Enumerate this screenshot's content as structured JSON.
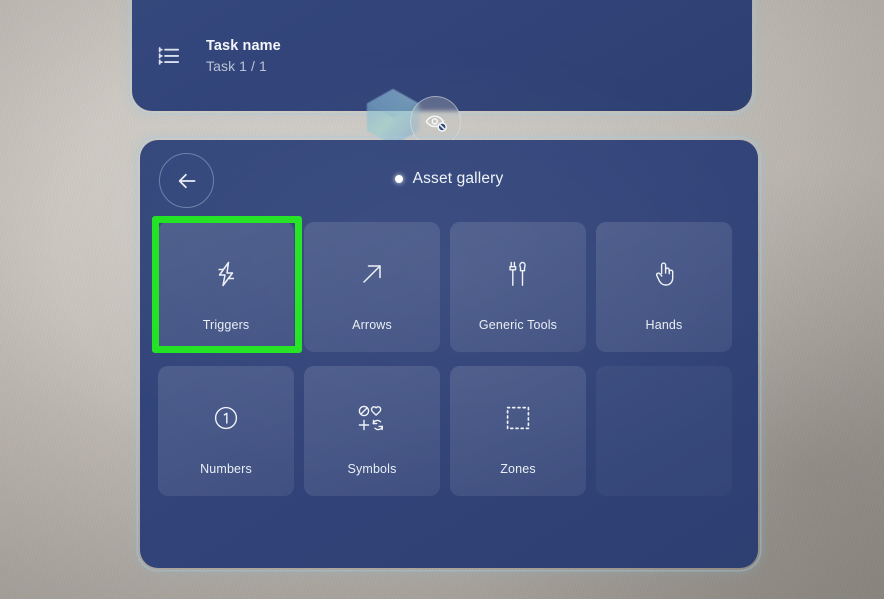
{
  "app": {
    "background_color": "#c3beb6",
    "panel_color": "#334579",
    "accent_color": "#22e322",
    "text_color": "#f0f4f9"
  },
  "task_panel": {
    "icon": "task-list-icon",
    "title": "Task name",
    "subtitle": "Task 1 / 1"
  },
  "floating_controls": {
    "gem": {
      "icon": "hexagon-gem-icon"
    },
    "visibility_toggle": {
      "icon": "eye-off-icon",
      "label": "Hide"
    }
  },
  "gallery": {
    "back_button": {
      "icon": "arrow-left-icon",
      "label": "Back"
    },
    "cursor": {
      "icon": "cursor-dot-icon"
    },
    "title": "Asset gallery",
    "tiles": [
      {
        "label": "Triggers",
        "icon": "lightning-bolt-icon",
        "selected": true,
        "empty": false
      },
      {
        "label": "Arrows",
        "icon": "arrow-up-right-icon",
        "selected": false,
        "empty": false
      },
      {
        "label": "Generic Tools",
        "icon": "tools-icon",
        "selected": false,
        "empty": false
      },
      {
        "label": "Hands",
        "icon": "pointing-hand-icon",
        "selected": false,
        "empty": false
      },
      {
        "label": "Numbers",
        "icon": "circled-one-icon",
        "selected": false,
        "empty": false
      },
      {
        "label": "Symbols",
        "icon": "symbols-grid-icon",
        "selected": false,
        "empty": false
      },
      {
        "label": "Zones",
        "icon": "dashed-square-icon",
        "selected": false,
        "empty": false
      },
      {
        "label": "",
        "icon": "",
        "selected": false,
        "empty": true
      }
    ]
  },
  "annotation": {
    "highlight_target": "Triggers",
    "highlight_color": "#22e322"
  }
}
